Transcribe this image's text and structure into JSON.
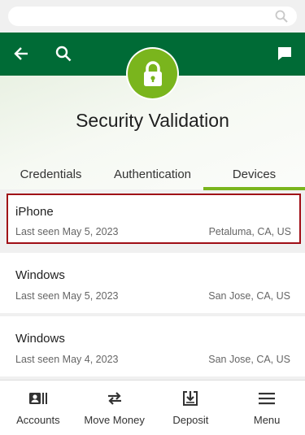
{
  "page": {
    "title": "Security Validation"
  },
  "tabs": [
    {
      "label": "Credentials"
    },
    {
      "label": "Authentication"
    },
    {
      "label": "Devices",
      "active": true
    }
  ],
  "devices": [
    {
      "name": "iPhone",
      "last_seen": "Last seen May 5, 2023",
      "location": "Petaluma, CA, US",
      "selected": true
    },
    {
      "name": "Windows",
      "last_seen": "Last seen May 5, 2023",
      "location": "San Jose, CA, US"
    },
    {
      "name": "Windows",
      "last_seen": "Last seen May 4, 2023",
      "location": "San Jose, CA, US"
    }
  ],
  "bottom_nav": [
    {
      "label": "Accounts",
      "icon": "accounts-icon"
    },
    {
      "label": "Move Money",
      "icon": "transfer-icon"
    },
    {
      "label": "Deposit",
      "icon": "deposit-icon"
    },
    {
      "label": "Menu",
      "icon": "menu-icon"
    }
  ],
  "colors": {
    "header_green": "#006b36",
    "accent_green": "#7ab51d",
    "selection_red": "#a00e16"
  },
  "icons": {
    "header": [
      "back-arrow-icon",
      "search-icon",
      "chat-icon"
    ],
    "badge": "lock-icon"
  }
}
